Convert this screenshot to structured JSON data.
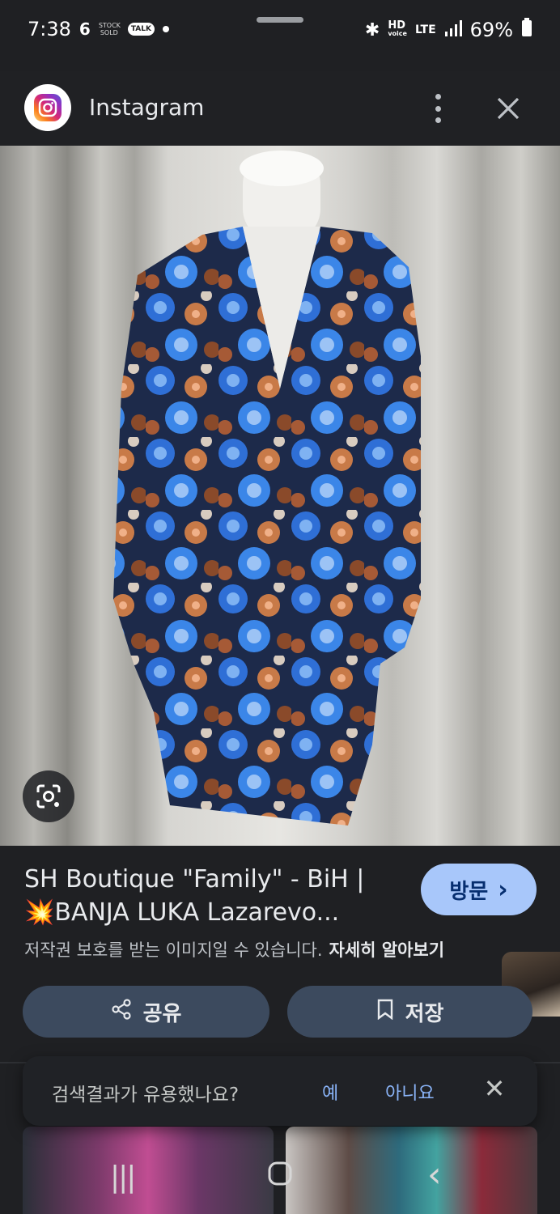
{
  "status_bar": {
    "time": "7:38",
    "notif_stock_text": "STOCK SOLD",
    "notif_talk_text": "TALK",
    "net_hd": "HD",
    "net_voice": "voice",
    "net_lte": "LTE",
    "battery": "69%"
  },
  "header": {
    "source_name": "Instagram",
    "icons": {
      "logo": "instagram-logo",
      "menu": "more-vert-icon",
      "close": "close-icon"
    }
  },
  "image": {
    "lens_icon": "google-lens-icon"
  },
  "result": {
    "title_line1": "SH Boutique \"Family\" - BiH |",
    "title_emoji": "💥",
    "title_line2": "BANJA LUKA Lazarevo...",
    "visit_label": "방문",
    "visit_arrow": "›",
    "copyright_notice": "저작권 보호를 받는 이미지일 수 있습니다.",
    "learn_more": "자세히 알아보기"
  },
  "actions": {
    "share_label": "공유",
    "save_label": "저장"
  },
  "feedback": {
    "question": "검색결과가 유용했나요?",
    "yes": "예",
    "no": "아니요",
    "close_glyph": "✕"
  },
  "nav": {
    "recents_glyph": "|||",
    "home_glyph": "○",
    "back_glyph": "‹"
  },
  "colors": {
    "background": "#1f2023",
    "visit_button": "#a8c7fa",
    "action_pill": "#3c4a5e",
    "link_blue": "#8ab4f8"
  }
}
